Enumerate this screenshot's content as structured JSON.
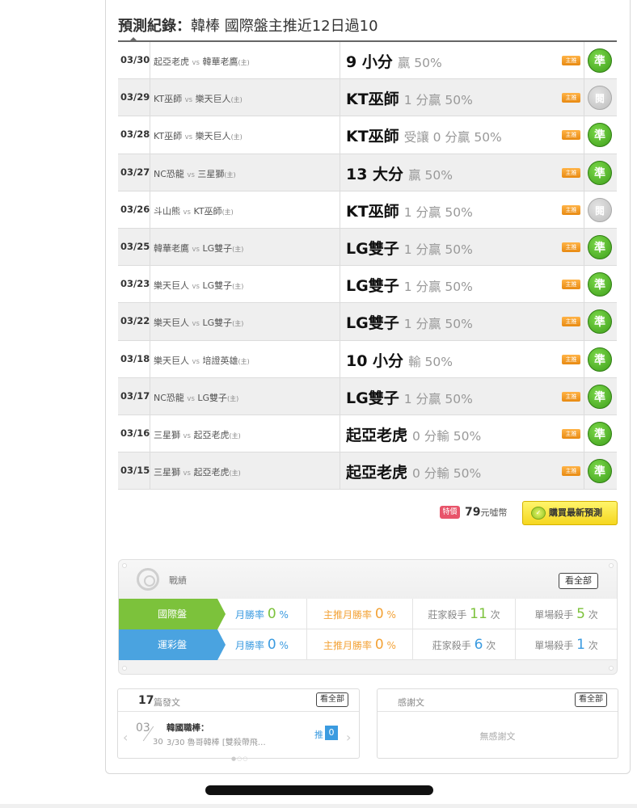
{
  "page_title": {
    "bold": "預測紀錄：",
    "rest": "韓棒 國際盤主推近12日過10"
  },
  "records": [
    {
      "date": "03/30",
      "team_a": "起亞老虎",
      "vs": "vs",
      "team_b": "韓華老鷹",
      "host": "(主)",
      "pick": "9 小分",
      "detail": "贏 50%",
      "tag": "主推",
      "result": "準",
      "result_type": "win"
    },
    {
      "date": "03/29",
      "team_a": "KT巫師",
      "vs": "vs",
      "team_b": "樂天巨人",
      "host": "(主)",
      "pick": "KT巫師",
      "detail": "1 分贏 50%",
      "tag": "主推",
      "result": "閱",
      "result_type": "lose"
    },
    {
      "date": "03/28",
      "team_a": "KT巫師",
      "vs": "vs",
      "team_b": "樂天巨人",
      "host": "(主)",
      "pick": "KT巫師",
      "detail": "受讓 0 分贏 50%",
      "tag": "主推",
      "result": "準",
      "result_type": "win"
    },
    {
      "date": "03/27",
      "team_a": "NC恐龍",
      "vs": "vs",
      "team_b": "三星獅",
      "host": "(主)",
      "pick": "13 大分",
      "detail": "贏 50%",
      "tag": "主推",
      "result": "準",
      "result_type": "win"
    },
    {
      "date": "03/26",
      "team_a": "斗山熊",
      "vs": "vs",
      "team_b": "KT巫師",
      "host": "(主)",
      "pick": "KT巫師",
      "detail": "1 分贏 50%",
      "tag": "主推",
      "result": "閱",
      "result_type": "lose"
    },
    {
      "date": "03/25",
      "team_a": "韓華老鷹",
      "vs": "vs",
      "team_b": "LG雙子",
      "host": "(主)",
      "pick": "LG雙子",
      "detail": "1 分贏 50%",
      "tag": "主推",
      "result": "準",
      "result_type": "win"
    },
    {
      "date": "03/23",
      "team_a": "樂天巨人",
      "vs": "vs",
      "team_b": "LG雙子",
      "host": "(主)",
      "pick": "LG雙子",
      "detail": "1 分贏 50%",
      "tag": "主推",
      "result": "準",
      "result_type": "win"
    },
    {
      "date": "03/22",
      "team_a": "樂天巨人",
      "vs": "vs",
      "team_b": "LG雙子",
      "host": "(主)",
      "pick": "LG雙子",
      "detail": "1 分贏 50%",
      "tag": "主推",
      "result": "準",
      "result_type": "win"
    },
    {
      "date": "03/18",
      "team_a": "樂天巨人",
      "vs": "vs",
      "team_b": "培證英雄",
      "host": "(主)",
      "pick": "10 小分",
      "detail": "輸 50%",
      "tag": "主推",
      "result": "準",
      "result_type": "win"
    },
    {
      "date": "03/17",
      "team_a": "NC恐龍",
      "vs": "vs",
      "team_b": "LG雙子",
      "host": "(主)",
      "pick": "LG雙子",
      "detail": "1 分贏 50%",
      "tag": "主推",
      "result": "準",
      "result_type": "win"
    },
    {
      "date": "03/16",
      "team_a": "三星獅",
      "vs": "vs",
      "team_b": "起亞老虎",
      "host": "(主)",
      "pick": "起亞老虎",
      "detail": "0 分輸 50%",
      "tag": "主推",
      "result": "準",
      "result_type": "win"
    },
    {
      "date": "03/15",
      "team_a": "三星獅",
      "vs": "vs",
      "team_b": "起亞老虎",
      "host": "(主)",
      "pick": "起亞老虎",
      "detail": "0 分輸 50%",
      "tag": "主推",
      "result": "準",
      "result_type": "win"
    }
  ],
  "purchase": {
    "special_label": "特價",
    "price": "79",
    "unit": "元噓幣",
    "button_label": "購買最新預測"
  },
  "stats": {
    "title": "戰績",
    "see_all": "看全部",
    "rows": [
      {
        "label": "國際盤",
        "month_rate_label": "月勝率",
        "month_rate": "0",
        "month_rate_unit": "%",
        "main_rate_label": "主推月勝率",
        "main_rate": "0",
        "main_rate_unit": "%",
        "banker_label": "莊家殺手",
        "banker": "11",
        "banker_unit": "次",
        "single_label": "單場殺手",
        "single": "5",
        "single_unit": "次"
      },
      {
        "label": "運彩盤",
        "month_rate_label": "月勝率",
        "month_rate": "0",
        "month_rate_unit": "%",
        "main_rate_label": "主推月勝率",
        "main_rate": "0",
        "main_rate_unit": "%",
        "banker_label": "莊家殺手",
        "banker": "6",
        "banker_unit": "次",
        "single_label": "單場殺手",
        "single": "1",
        "single_unit": "次"
      }
    ]
  },
  "posts": {
    "count": "17",
    "label": "篇發文",
    "see_all": "看全部",
    "date_big": "03",
    "date_small": "30",
    "title": "韓國職棒：",
    "excerpt": "3/30 魯哥韓棒 [雙殺帶飛…",
    "push_label": "推",
    "push_count": "0",
    "prev_arrow": "‹",
    "next_arrow": "›",
    "pager": "●○○"
  },
  "thanks": {
    "label": "感謝文",
    "see_all": "看全部",
    "empty": "無感謝文"
  }
}
